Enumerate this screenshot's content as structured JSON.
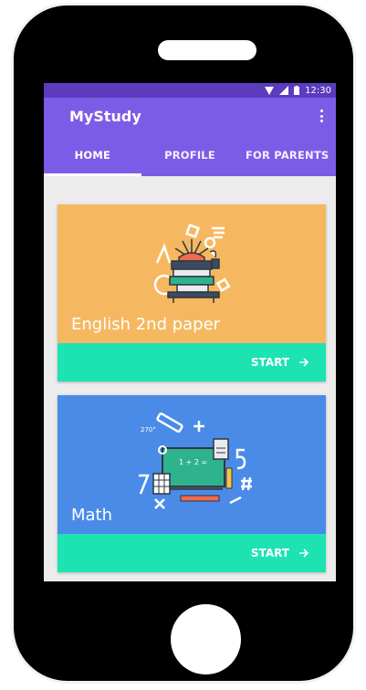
{
  "status_bar": {
    "time": "12:30",
    "icons": [
      "wifi-icon",
      "signal-icon",
      "battery-icon"
    ]
  },
  "app": {
    "title": "MyStudy",
    "menu_icon": "more-vert-icon"
  },
  "tabs": [
    {
      "label": "HOME",
      "active": true
    },
    {
      "label": "PROFILE",
      "active": false
    },
    {
      "label": "FOR PARENTS",
      "active": false
    }
  ],
  "cards": [
    {
      "title": "English 2nd paper",
      "action_label": "START",
      "action_icon": "arrow-right-icon",
      "color": "#f5b860"
    },
    {
      "title": "Math",
      "action_label": "START",
      "action_icon": "arrow-right-icon",
      "color": "#4a8be8",
      "illustration_text": "1 + 2 =",
      "angle_label": "270°"
    }
  ],
  "colors": {
    "primary": "#7b5ce6",
    "primary_dark": "#5d3bbd",
    "accent": "#1de3b2",
    "background": "#ececec"
  }
}
